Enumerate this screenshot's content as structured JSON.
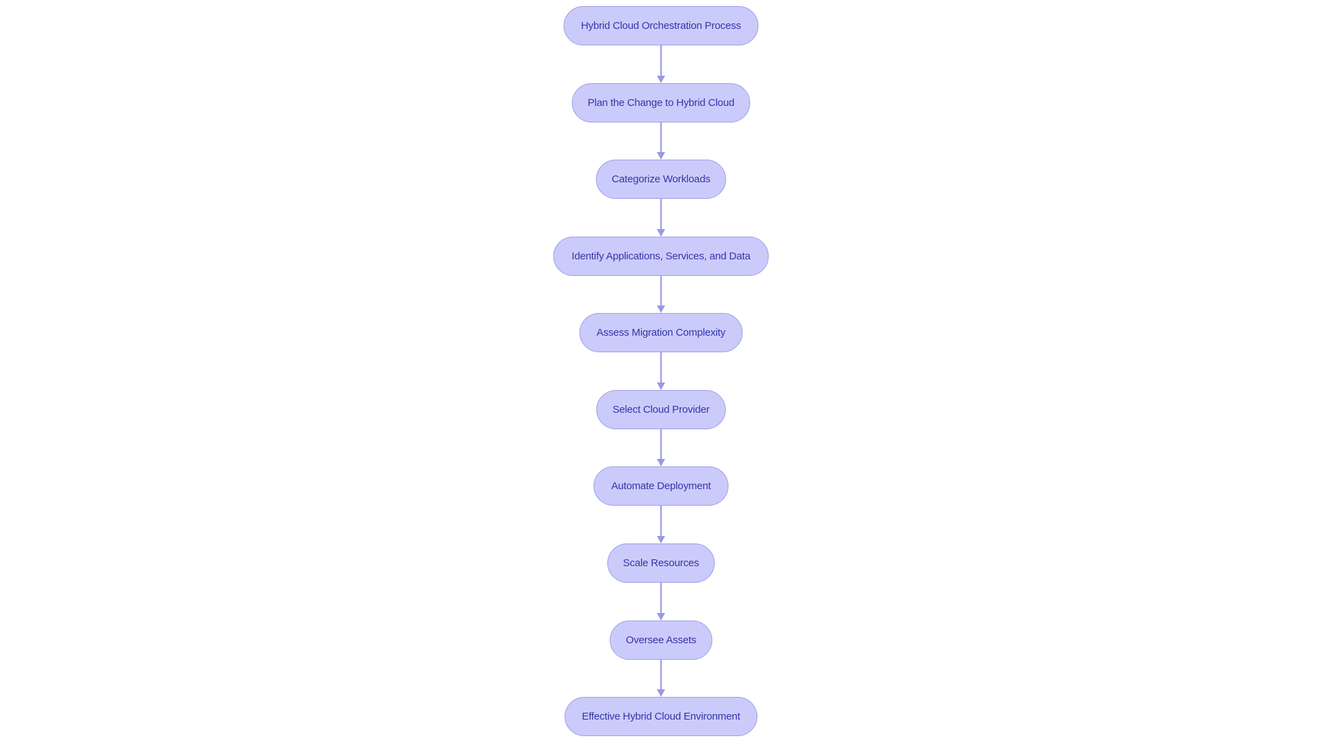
{
  "diagram": {
    "type": "flowchart",
    "direction": "top-to-bottom",
    "colors": {
      "node_fill": "#cbcbfb",
      "node_border": "#9d9de6",
      "node_text": "#3535a8",
      "edge": "#9999e4",
      "background": "#ffffff"
    },
    "nodes": [
      {
        "id": "n1",
        "label": "Hybrid Cloud Orchestration Process"
      },
      {
        "id": "n2",
        "label": "Plan the Change to Hybrid Cloud"
      },
      {
        "id": "n3",
        "label": "Categorize Workloads"
      },
      {
        "id": "n4",
        "label": "Identify Applications, Services, and Data"
      },
      {
        "id": "n5",
        "label": "Assess Migration Complexity"
      },
      {
        "id": "n6",
        "label": "Select Cloud Provider"
      },
      {
        "id": "n7",
        "label": "Automate Deployment"
      },
      {
        "id": "n8",
        "label": "Scale Resources"
      },
      {
        "id": "n9",
        "label": "Oversee Assets"
      },
      {
        "id": "n10",
        "label": "Effective Hybrid Cloud Environment"
      }
    ],
    "edges": [
      {
        "from": "n1",
        "to": "n2"
      },
      {
        "from": "n2",
        "to": "n3"
      },
      {
        "from": "n3",
        "to": "n4"
      },
      {
        "from": "n4",
        "to": "n5"
      },
      {
        "from": "n5",
        "to": "n6"
      },
      {
        "from": "n6",
        "to": "n7"
      },
      {
        "from": "n7",
        "to": "n8"
      },
      {
        "from": "n8",
        "to": "n9"
      },
      {
        "from": "n9",
        "to": "n10"
      }
    ]
  }
}
